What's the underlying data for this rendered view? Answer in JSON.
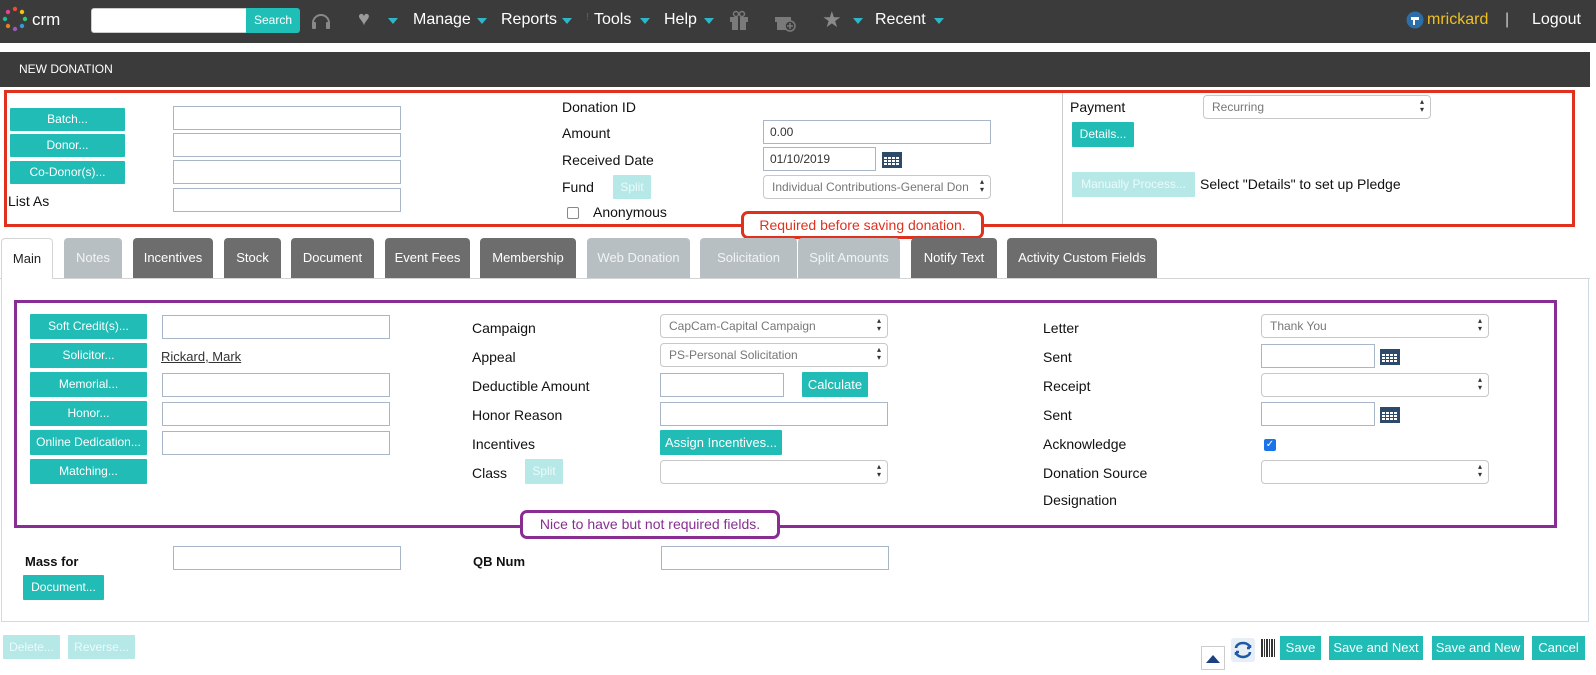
{
  "nav": {
    "logo_text": "crm",
    "search_placeholder": "",
    "search_button": "Search",
    "menus": [
      "Manage",
      "Reports",
      "Tools",
      "Help",
      "Recent"
    ],
    "tools_badge": "!",
    "user": "mrickard",
    "separator": "|",
    "logout": "Logout"
  },
  "header": {
    "title": "NEW DONATION"
  },
  "donation": {
    "batch_button": "Batch...",
    "donor_button": "Donor...",
    "codonor_button": "Co-Donor(s)...",
    "list_as_label": "List As",
    "donation_id_label": "Donation ID",
    "amount_label": "Amount",
    "amount_value": "0.00",
    "received_date_label": "Received Date",
    "received_date_value": "01/10/2019",
    "fund_label": "Fund",
    "fund_split_button": "Split",
    "fund_value": "Individual Contributions-General Don",
    "anonymous_label": "Anonymous",
    "payment_label": "Payment",
    "payment_value": "Recurring",
    "details_button": "Details...",
    "manual_process_button": "Manually Process...",
    "pledge_hint": "Select \"Details\" to set up Pledge"
  },
  "annotations": {
    "required_note": "Required before saving donation.",
    "optional_note": "Nice to have but not required fields."
  },
  "tabs": [
    "Main",
    "Notes",
    "Incentives",
    "Stock",
    "Document",
    "Event Fees",
    "Membership",
    "Web Donation",
    "Solicitation",
    "Split Amounts",
    "Notify Text",
    "Activity Custom Fields"
  ],
  "main": {
    "soft_credit_button": "Soft Credit(s)...",
    "solicitor_button": "Solicitor...",
    "solicitor_value": "Rickard, Mark",
    "memorial_button": "Memorial...",
    "honor_button": "Honor...",
    "online_dedication_button": "Online Dedication...",
    "matching_button": "Matching...",
    "campaign_label": "Campaign",
    "campaign_value": "CapCam-Capital Campaign",
    "appeal_label": "Appeal",
    "appeal_value": "PS-Personal Solicitation",
    "deductible_label": "Deductible Amount",
    "calculate_button": "Calculate",
    "honor_reason_label": "Honor Reason",
    "incentives_label": "Incentives",
    "assign_incentives_button": "Assign Incentives...",
    "class_label": "Class",
    "class_split_button": "Split",
    "letter_label": "Letter",
    "letter_value": "Thank You",
    "sent_label": "Sent",
    "receipt_label": "Receipt",
    "sent2_label": "Sent",
    "acknowledge_label": "Acknowledge",
    "donation_source_label": "Donation Source",
    "designation_label": "Designation"
  },
  "extra": {
    "mass_for_label": "Mass for",
    "qb_num_label": "QB Num",
    "document_button": "Document..."
  },
  "footer": {
    "delete_button": "Delete...",
    "reverse_button": "Reverse...",
    "save_button": "Save",
    "save_next_button": "Save and Next",
    "save_new_button": "Save and New",
    "cancel_button": "Cancel"
  },
  "colors": {
    "accent": "#20bcb5",
    "required": "#e0311f",
    "optional": "#8a2d93",
    "nav_bg": "#3b3b3b",
    "user_link": "#f0c020"
  }
}
